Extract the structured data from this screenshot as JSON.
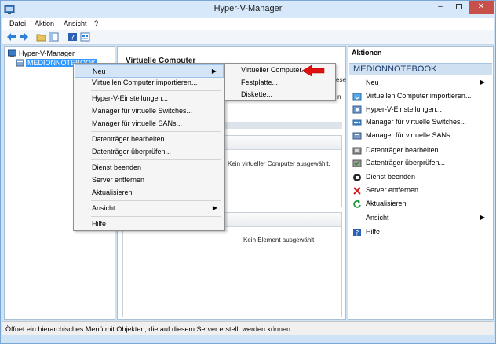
{
  "window": {
    "title": "Hyper-V-Manager",
    "controls": {
      "minimize": "–",
      "close": "✕"
    }
  },
  "menubar": [
    "Datei",
    "Aktion",
    "Ansicht",
    "?"
  ],
  "tree": {
    "root": "Hyper-V-Manager",
    "node": "MEDIONNOTEBOOK"
  },
  "center": {
    "title": "Virtuelle Computer",
    "no_vm": "Kein virtueller Computer ausgewählt.",
    "no_item": "Kein Element ausgewählt.",
    "edge_texts": [
      "ese",
      "n"
    ]
  },
  "actions": {
    "title": "Aktionen",
    "group": "MEDIONNOTEBOOK",
    "items": [
      {
        "label": "Neu",
        "icon": "none",
        "submenu": true
      },
      {
        "label": "Virtuellen Computer importieren...",
        "icon": "import-icon"
      },
      {
        "label": "Hyper-V-Einstellungen...",
        "icon": "settings-icon"
      },
      {
        "label": "Manager für virtuelle Switches...",
        "icon": "switch-icon"
      },
      {
        "label": "Manager für virtuelle SANs...",
        "icon": "san-icon"
      },
      {
        "label": "Datenträger bearbeiten...",
        "icon": "disk-edit-icon"
      },
      {
        "label": "Datenträger überprüfen...",
        "icon": "disk-check-icon"
      },
      {
        "label": "Dienst beenden",
        "icon": "stop-icon"
      },
      {
        "label": "Server entfernen",
        "icon": "remove-icon"
      },
      {
        "label": "Aktualisieren",
        "icon": "refresh-icon"
      },
      {
        "label": "Ansicht",
        "icon": "none",
        "submenu": true
      },
      {
        "label": "Hilfe",
        "icon": "help-icon"
      }
    ]
  },
  "context_menu": {
    "items": [
      {
        "label": "Neu",
        "submenu": true
      },
      {
        "label": "Virtuellen Computer importieren..."
      },
      {
        "label": "Hyper-V-Einstellungen..."
      },
      {
        "label": "Manager für virtuelle Switches..."
      },
      {
        "label": "Manager für virtuelle SANs..."
      },
      {
        "label": "Datenträger bearbeiten..."
      },
      {
        "label": "Datenträger überprüfen..."
      },
      {
        "label": "Dienst beenden"
      },
      {
        "label": "Server entfernen"
      },
      {
        "label": "Aktualisieren"
      },
      {
        "label": "Ansicht",
        "submenu": true
      },
      {
        "label": "Hilfe"
      }
    ],
    "submenu_arrow": "▶"
  },
  "sub_menu": {
    "items": [
      "Virtueller Computer...",
      "Festplatte...",
      "Diskette..."
    ]
  },
  "status": "Öffnet ein hierarchisches Menü mit Objekten, die auf diesem Server erstellt werden können.",
  "colors": {
    "accent": "#3399ff",
    "close_button": "#c7504a",
    "arrow_red": "#e01010"
  }
}
